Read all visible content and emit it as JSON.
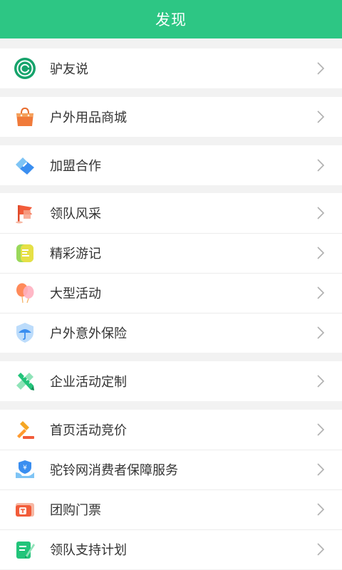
{
  "header": {
    "title": "发现"
  },
  "groups": [
    {
      "items": [
        {
          "label": "驴友说",
          "icon": "lvyoushuo-icon"
        }
      ]
    },
    {
      "items": [
        {
          "label": "户外用品商城",
          "icon": "shopping-bag-icon"
        }
      ]
    },
    {
      "items": [
        {
          "label": "加盟合作",
          "icon": "handshake-icon"
        }
      ]
    },
    {
      "items": [
        {
          "label": "领队风采",
          "icon": "flag-icon"
        },
        {
          "label": "精彩游记",
          "icon": "notebook-icon"
        },
        {
          "label": "大型活动",
          "icon": "balloon-icon"
        },
        {
          "label": "户外意外保险",
          "icon": "umbrella-shield-icon"
        }
      ]
    },
    {
      "items": [
        {
          "label": "企业活动定制",
          "icon": "ruler-pencil-icon"
        }
      ]
    },
    {
      "items": [
        {
          "label": "首页活动竞价",
          "icon": "auction-hammer-icon"
        },
        {
          "label": "驼铃网消费者保障服务",
          "icon": "protection-hand-icon"
        },
        {
          "label": "团购门票",
          "icon": "ticket-icon"
        },
        {
          "label": "领队支持计划",
          "icon": "support-plan-icon"
        }
      ]
    }
  ],
  "colors": {
    "brand": "#2dc684",
    "background": "#f2f2f2",
    "text": "#333333",
    "chevron": "#b0b0b0"
  }
}
